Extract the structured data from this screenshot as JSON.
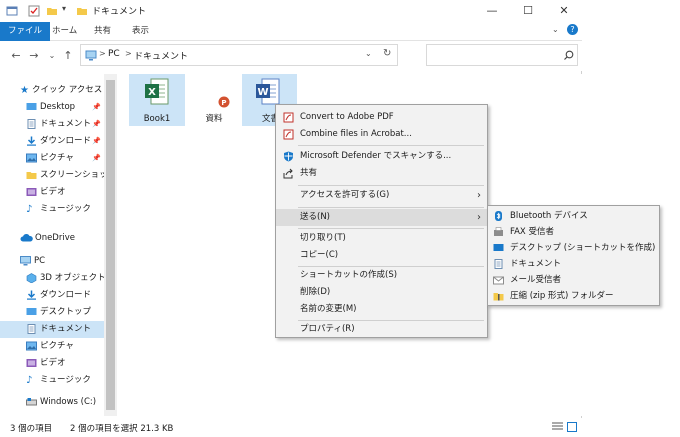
{
  "window": {
    "title": "ドキュメント",
    "minimize": "—",
    "maximize": "☐",
    "close": "✕"
  },
  "ribbon": {
    "tabs": [
      "ファイル",
      "ホーム",
      "共有",
      "表示"
    ],
    "active_color": "#1979ca"
  },
  "address": {
    "path_pc": "PC",
    "path_sep": ">",
    "path_folder": "ドキュメント",
    "search_placeholder": ""
  },
  "nav": {
    "quick_access": "クイック アクセス",
    "items": [
      {
        "label": "Desktop",
        "pinned": true
      },
      {
        "label": "ドキュメント",
        "pinned": true
      },
      {
        "label": "ダウンロード",
        "pinned": true
      },
      {
        "label": "ピクチャ",
        "pinned": true
      },
      {
        "label": "スクリーンショット",
        "pinned": false
      },
      {
        "label": "ビデオ",
        "pinned": false
      },
      {
        "label": "ミュージック",
        "pinned": false
      }
    ],
    "onedrive": "OneDrive",
    "pc": "PC",
    "pc_items": [
      "3D オブジェクト",
      "ダウンロード",
      "デスクトップ",
      "ドキュメント",
      "ピクチャ",
      "ビデオ",
      "ミュージック",
      "Windows (C:)"
    ],
    "pin_glyph": "📌"
  },
  "files": [
    {
      "name": "Book1",
      "type": "excel"
    },
    {
      "name": "資料",
      "type": "powerpoint"
    },
    {
      "name": "文書",
      "type": "word"
    }
  ],
  "status": {
    "count": "3 個の項目",
    "selection": "2 個の項目を選択  21.3 KB"
  },
  "context_menu": {
    "items": [
      "Convert to Adobe PDF",
      "Combine files in Acrobat...",
      "Microsoft Defender でスキャンする...",
      "共有",
      "アクセスを許可する(G)",
      "送る(N)",
      "切り取り(T)",
      "コピー(C)",
      "ショートカットの作成(S)",
      "削除(D)",
      "名前の変更(M)",
      "プロパティ(R)"
    ],
    "arrow": "›"
  },
  "send_to": {
    "items": [
      "Bluetooth デバイス",
      "FAX 受信者",
      "デスクトップ (ショートカットを作成)",
      "ドキュメント",
      "メール受信者",
      "圧縮 (zip 形式) フォルダー"
    ]
  }
}
